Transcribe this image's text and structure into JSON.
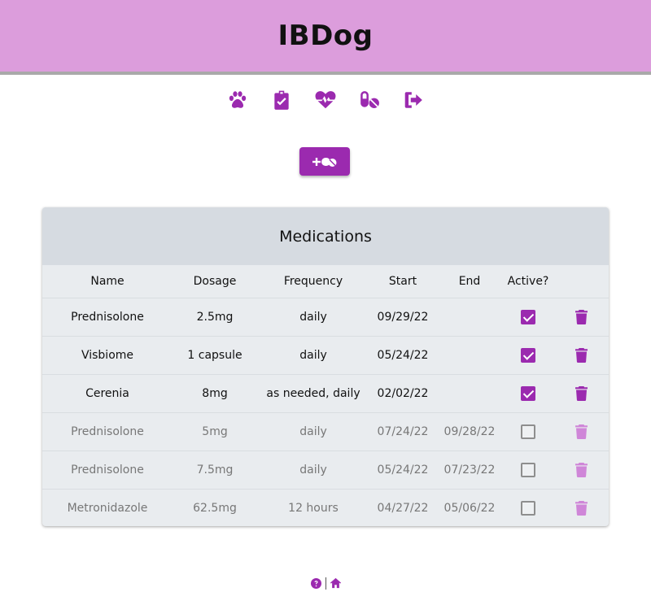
{
  "app": {
    "title": "IBDog"
  },
  "nav": {
    "items": [
      {
        "icon": "paw-icon"
      },
      {
        "icon": "clipboard-check-icon"
      },
      {
        "icon": "heart-pulse-icon"
      },
      {
        "icon": "pills-icon"
      },
      {
        "icon": "sign-out-icon"
      }
    ]
  },
  "add_button": {
    "icon": "add-pill-icon"
  },
  "medications": {
    "title": "Medications",
    "columns": [
      "Name",
      "Dosage",
      "Frequency",
      "Start",
      "End",
      "Active?",
      ""
    ],
    "rows": [
      {
        "name": "Prednisolone",
        "dosage": "2.5mg",
        "frequency": "daily",
        "start": "09/29/22",
        "end": "",
        "active": true
      },
      {
        "name": "Visbiome",
        "dosage": "1 capsule",
        "frequency": "daily",
        "start": "05/24/22",
        "end": "",
        "active": true
      },
      {
        "name": "Cerenia",
        "dosage": "8mg",
        "frequency": "as needed, daily",
        "start": "02/02/22",
        "end": "",
        "active": true
      },
      {
        "name": "Prednisolone",
        "dosage": "5mg",
        "frequency": "daily",
        "start": "07/24/22",
        "end": "09/28/22",
        "active": false
      },
      {
        "name": "Prednisolone",
        "dosage": "7.5mg",
        "frequency": "daily",
        "start": "05/24/22",
        "end": "07/23/22",
        "active": false
      },
      {
        "name": "Metronidazole",
        "dosage": "62.5mg",
        "frequency": "12 hours",
        "start": "04/27/22",
        "end": "05/06/22",
        "active": false
      }
    ]
  },
  "footer": {
    "icons": [
      "help-icon",
      "home-icon"
    ]
  },
  "colors": {
    "accent": "#9b2aaf",
    "header_bg": "#dc9ddc",
    "card_bg": "#e9ecef",
    "card_header_bg": "#d6dbe1"
  }
}
